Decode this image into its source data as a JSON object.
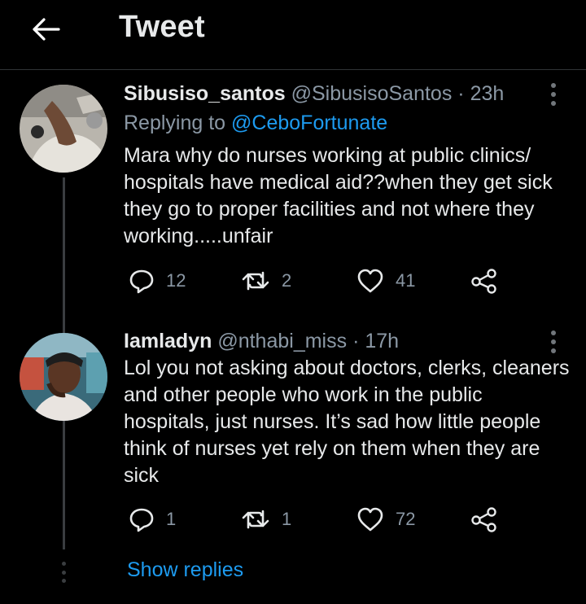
{
  "header": {
    "title": "Tweet"
  },
  "tweets": [
    {
      "name": "Sibusiso_santos",
      "handle": "@SibusisoSantos",
      "time": "· 23h",
      "replying_prefix": "Replying to",
      "replying_to": "@CeboFortunate",
      "lines": [
        "Mara why do nurses working at public clinics/",
        "hospitals have medical aid??when they get sick",
        "they go to proper facilities and not  where they",
        "working.....unfair"
      ],
      "replies": "12",
      "retweets": "2",
      "likes": "41"
    },
    {
      "name": "Iamladyn",
      "handle": "@nthabi_miss",
      "time": "· 17h",
      "lines": [
        "Lol you not asking about doctors, clerks, cleaners",
        "and other people who work in the public",
        "hospitals, just nurses. It’s sad how little people",
        "think of nurses yet rely on them when they are",
        "sick"
      ],
      "replies": "1",
      "retweets": "1",
      "likes": "72"
    }
  ],
  "show_replies_label": "Show replies",
  "colors": {
    "accent": "#1d9bf0",
    "background": "#000000",
    "muted": "#8b98a5"
  },
  "icons": [
    "back-arrow-icon",
    "more-icon",
    "reply-icon",
    "retweet-icon",
    "like-icon",
    "share-icon"
  ]
}
